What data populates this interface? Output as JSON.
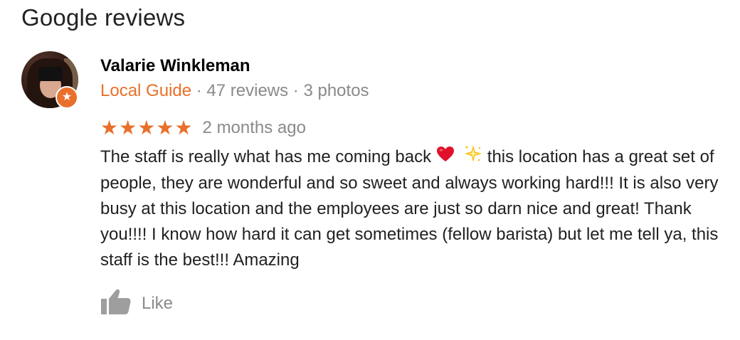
{
  "header": {
    "title": "Google reviews"
  },
  "review": {
    "author": "Valarie Winkleman",
    "badge": "Local Guide",
    "separator": " · ",
    "reviews_count": "47 reviews",
    "photos_count": "3 photos",
    "rating": 5,
    "time": "2 months ago",
    "text_part1": "The staff is really what has me coming back ",
    "text_part2": " this location has a great set of people, they are wonderful and so sweet and always working hard!!! It is also very busy at this location and the employees are just so darn nice and great! Thank you!!!! I know how hard it can get sometimes (fellow barista) but let me tell ya, this staff is the best!!! Amazing"
  },
  "actions": {
    "like_label": "Like"
  },
  "colors": {
    "accent": "#e8702a",
    "secondary_text": "#8a8a8a",
    "heart": "#e0102a",
    "sparkle": "#f7c21a"
  }
}
